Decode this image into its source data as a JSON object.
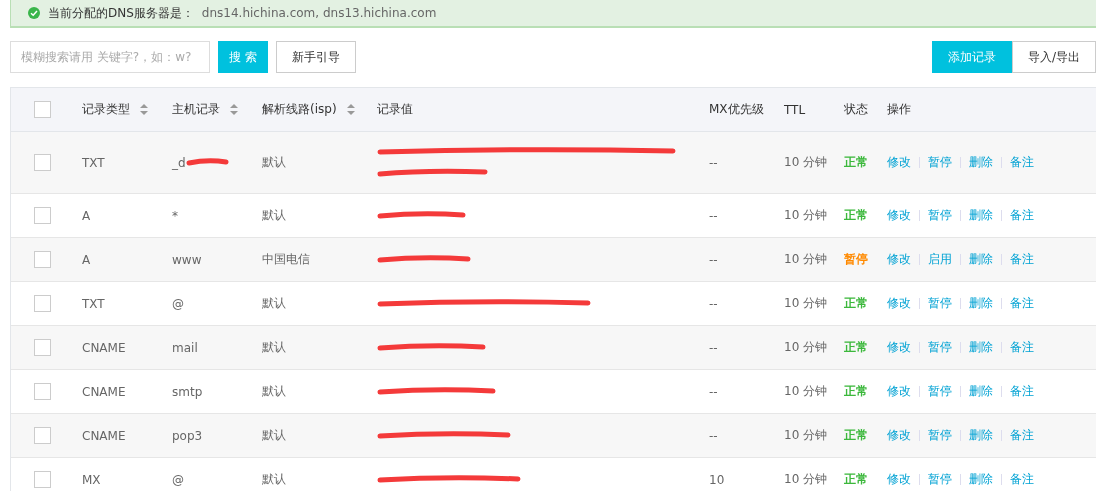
{
  "notice": {
    "text": "当前分配的DNS服务器是：",
    "servers": "dns14.hichina.com, dns13.hichina.com"
  },
  "toolbar": {
    "search": {
      "placeholder": "模糊搜索请用 关键字?，如：w?"
    },
    "search_button": "搜 索",
    "guide_button": "新手引导",
    "add_button": "添加记录",
    "import_button": "导入/导出"
  },
  "table": {
    "select_all": {
      "checked": false
    },
    "columns": [
      {
        "label": "记录类型",
        "sortable": true
      },
      {
        "label": "主机记录",
        "sortable": true
      },
      {
        "label": "解析线路(isp)",
        "sortable": true
      },
      {
        "label": "记录值",
        "sortable": false
      },
      {
        "label": "MX优先级",
        "sortable": false
      },
      {
        "label": "TTL",
        "sortable": false
      },
      {
        "label": "状态",
        "sortable": false
      },
      {
        "label": "操作",
        "sortable": false
      }
    ],
    "rows": [
      {
        "checked": false,
        "type": "TXT",
        "host": "_d",
        "host_redacted": true,
        "line": "默认",
        "wrapped": true,
        "mx": "--",
        "ttl": "10 分钟",
        "status": {
          "text": "正常",
          "color": "#3cb83c"
        },
        "actions": [
          "修改",
          "暂停",
          "删除",
          "备注"
        ]
      },
      {
        "checked": false,
        "type": "A",
        "host": "*",
        "host_redacted": false,
        "line": "默认",
        "wrapped": false,
        "mx": "--",
        "ttl": "10 分钟",
        "status": {
          "text": "正常",
          "color": "#3cb83c"
        },
        "actions": [
          "修改",
          "暂停",
          "删除",
          "备注"
        ]
      },
      {
        "checked": false,
        "type": "A",
        "host": "www",
        "host_redacted": false,
        "line": "中国电信",
        "wrapped": false,
        "mx": "--",
        "ttl": "10 分钟",
        "status": {
          "text": "暂停",
          "color": "#ff8a00"
        },
        "actions": [
          "修改",
          "启用",
          "删除",
          "备注"
        ]
      },
      {
        "checked": false,
        "type": "TXT",
        "host": "@",
        "host_redacted": false,
        "line": "默认",
        "wrapped": false,
        "mx": "--",
        "ttl": "10 分钟",
        "status": {
          "text": "正常",
          "color": "#3cb83c"
        },
        "actions": [
          "修改",
          "暂停",
          "删除",
          "备注"
        ]
      },
      {
        "checked": false,
        "type": "CNAME",
        "host": "mail",
        "host_redacted": false,
        "line": "默认",
        "wrapped": false,
        "mx": "--",
        "ttl": "10 分钟",
        "status": {
          "text": "正常",
          "color": "#3cb83c"
        },
        "actions": [
          "修改",
          "暂停",
          "删除",
          "备注"
        ]
      },
      {
        "checked": false,
        "type": "CNAME",
        "host": "smtp",
        "host_redacted": false,
        "line": "默认",
        "wrapped": false,
        "mx": "--",
        "ttl": "10 分钟",
        "status": {
          "text": "正常",
          "color": "#3cb83c"
        },
        "actions": [
          "修改",
          "暂停",
          "删除",
          "备注"
        ]
      },
      {
        "checked": false,
        "type": "CNAME",
        "host": "pop3",
        "host_redacted": false,
        "line": "默认",
        "wrapped": false,
        "mx": "--",
        "ttl": "10 分钟",
        "status": {
          "text": "正常",
          "color": "#3cb83c"
        },
        "actions": [
          "修改",
          "暂停",
          "删除",
          "备注"
        ]
      },
      {
        "checked": false,
        "type": "MX",
        "host": "@",
        "host_redacted": false,
        "line": "默认",
        "wrapped": false,
        "mx": "10",
        "ttl": "10 分钟",
        "status": {
          "text": "正常",
          "color": "#3cb83c"
        },
        "actions": [
          "修改",
          "暂停",
          "删除",
          "备注"
        ]
      }
    ]
  }
}
